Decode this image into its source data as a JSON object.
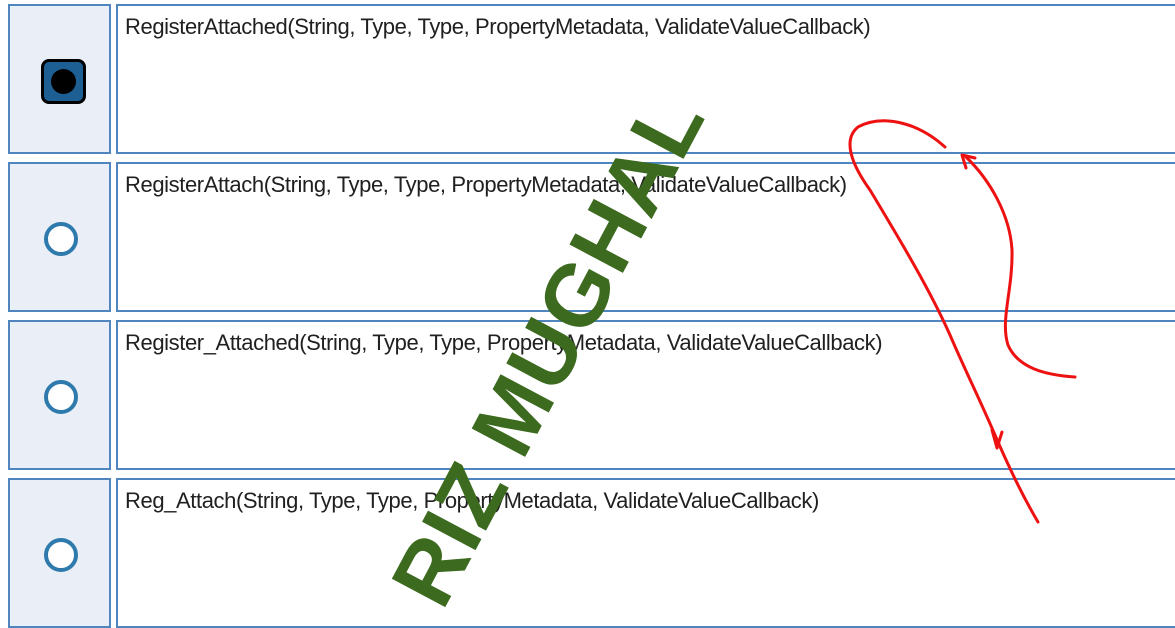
{
  "question": {
    "options": [
      {
        "label": "RegisterAttached(String, Type, Type, PropertyMetadata, ValidateValueCallback)",
        "selected": true
      },
      {
        "label": "RegisterAttach(String, Type, Type, PropertyMetadata, ValidateValueCallback)",
        "selected": false
      },
      {
        "label": "Register_Attached(String, Type, Type, PropertyMetadata, ValidateValueCallback)",
        "selected": false
      },
      {
        "label": "Reg_Attach(String, Type, Type, PropertyMetadata, ValidateValueCallback)",
        "selected": false
      }
    ]
  },
  "watermark": {
    "text": "RIZ MUGHAL",
    "color": "#3c6a1e"
  },
  "annotation": {
    "color": "#ee1111"
  },
  "colors": {
    "border": "#4f86c0",
    "radio_cell_bg": "#e9eef7",
    "radio_ring": "#2f7aad"
  }
}
